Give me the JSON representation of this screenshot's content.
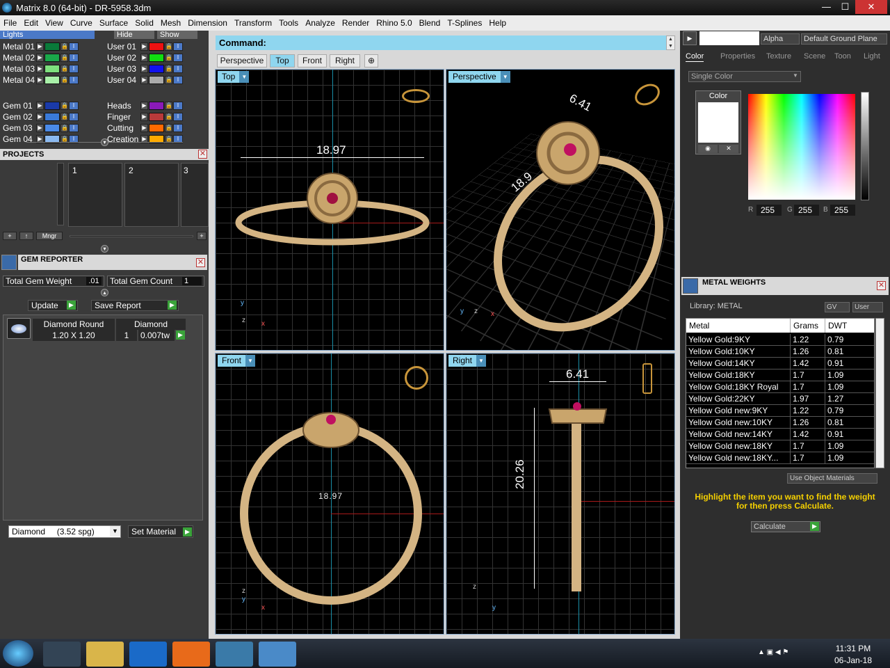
{
  "window": {
    "title": "Matrix 8.0 (64-bit) - DR-5958.3dm",
    "minimize": "—",
    "maximize": "☐",
    "close": "✕"
  },
  "menu": [
    "File",
    "Edit",
    "View",
    "Curve",
    "Surface",
    "Solid",
    "Mesh",
    "Dimension",
    "Transform",
    "Tools",
    "Analyze",
    "Render",
    "Rhino 5.0",
    "Blend",
    "T-Splines",
    "Help"
  ],
  "layers": {
    "lights_label": "Lights",
    "hide_label": "Hide",
    "show_label": "Show",
    "left": [
      {
        "name": "Metal 01",
        "color": "#0a7a3a"
      },
      {
        "name": "Metal 02",
        "color": "#1aa84a"
      },
      {
        "name": "Metal 03",
        "color": "#7ee07e"
      },
      {
        "name": "Metal 04",
        "color": "#a8f0a8"
      },
      {
        "name": "Gem 01",
        "color": "#1a3aa8"
      },
      {
        "name": "Gem 02",
        "color": "#3a7ad8"
      },
      {
        "name": "Gem 03",
        "color": "#4a8ae8"
      },
      {
        "name": "Gem 04",
        "color": "#8ab8f0"
      }
    ],
    "right": [
      {
        "name": "User 01",
        "color": "#ee1111"
      },
      {
        "name": "User 02",
        "color": "#11dd11"
      },
      {
        "name": "User 03",
        "color": "#1111ee"
      },
      {
        "name": "User 04",
        "color": "#aaaaaa"
      },
      {
        "name": "Heads",
        "color": "#8a1ab8"
      },
      {
        "name": "Finger",
        "color": "#b83a3a"
      },
      {
        "name": "Cutting",
        "color": "#ff6a00"
      },
      {
        "name": "Creation",
        "color": "#ffaa00"
      }
    ]
  },
  "projects": {
    "title": "PROJECTS",
    "slots": [
      "1",
      "2",
      "3"
    ],
    "mngr": "Mngr"
  },
  "gem_reporter": {
    "title": "GEM REPORTER",
    "total_weight_label": "Total Gem Weight",
    "total_weight": ".01",
    "total_count_label": "Total Gem Count",
    "total_count": "1",
    "update": "Update",
    "save_report": "Save Report",
    "gem": {
      "shape": "Diamond Round",
      "material": "Diamond",
      "size": "1.20 X 1.20",
      "count": "1",
      "weight": "0.007tw"
    },
    "material_select": "Diamond     (3.52 spg)",
    "set_material": "Set Material"
  },
  "command": {
    "label": "Command:"
  },
  "view_tabs": [
    "Perspective",
    "Top",
    "Front",
    "Right"
  ],
  "active_tab": "Top",
  "viewports": {
    "top": {
      "label": "Top",
      "dim": "18.97"
    },
    "perspective": {
      "label": "Perspective",
      "dim1": "6.41",
      "dim2": "18.9"
    },
    "front": {
      "label": "Front",
      "dim": "18.97"
    },
    "right": {
      "label": "Right",
      "dim1": "6.41",
      "dim2": "20.26"
    }
  },
  "right_panel": {
    "alpha": "Alpha",
    "ground_plane": "Default Ground Plane",
    "tabs": [
      "Color",
      "Properties",
      "Texture",
      "Scene",
      "Toon",
      "Light"
    ],
    "color_mode": "Single Color",
    "color_label": "Color",
    "r": "255",
    "g": "255",
    "b": "255"
  },
  "metal_weights": {
    "title": "METAL WEIGHTS",
    "library": "Library: METAL",
    "gv": "GV",
    "user": "User",
    "headers": [
      "Metal",
      "Grams",
      "DWT"
    ],
    "rows": [
      [
        "Yellow Gold:9KY",
        "1.22",
        "0.79"
      ],
      [
        "Yellow Gold:10KY",
        "1.26",
        "0.81"
      ],
      [
        "Yellow Gold:14KY",
        "1.42",
        "0.91"
      ],
      [
        "Yellow Gold:18KY",
        "1.7",
        "1.09"
      ],
      [
        "Yellow Gold:18KY Royal",
        "1.7",
        "1.09"
      ],
      [
        "Yellow Gold:22KY",
        "1.97",
        "1.27"
      ],
      [
        "Yellow Gold new:9KY",
        "1.22",
        "0.79"
      ],
      [
        "Yellow Gold new:10KY",
        "1.26",
        "0.81"
      ],
      [
        "Yellow Gold new:14KY",
        "1.42",
        "0.91"
      ],
      [
        "Yellow Gold new:18KY",
        "1.7",
        "1.09"
      ],
      [
        "Yellow Gold new:18KY...",
        "1.7",
        "1.09"
      ]
    ],
    "use_object_materials": "Use Object Materials",
    "hint": "Highlight the item you want to find the weight for then press Calculate.",
    "calculate": "Calculate"
  },
  "taskbar": {
    "time": "11:31 PM",
    "date": "06-Jan-18"
  }
}
